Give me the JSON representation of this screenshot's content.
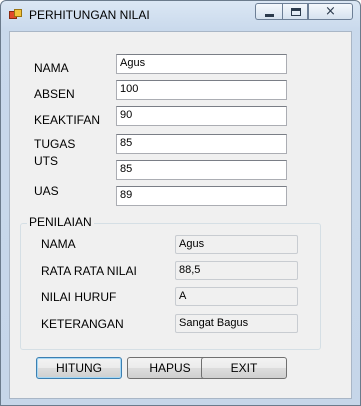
{
  "window": {
    "title": "PERHITUNGAN NILAI",
    "controls": {
      "minimize": "minimize",
      "maximize": "maximize",
      "close": "×"
    }
  },
  "form": {
    "fields": [
      {
        "label": "NAMA",
        "value": "Agus"
      },
      {
        "label": "ABSEN",
        "value": "100"
      },
      {
        "label": "KEAKTIFAN",
        "value": "90"
      },
      {
        "label": "TUGAS",
        "value": "85"
      },
      {
        "label": "UTS",
        "value": "85"
      },
      {
        "label": "UAS",
        "value": "89"
      }
    ]
  },
  "penilaian": {
    "title": "PENILAIAN",
    "rows": [
      {
        "label": "NAMA",
        "value": "Agus"
      },
      {
        "label": "RATA RATA NILAI",
        "value": "88,5"
      },
      {
        "label": "NILAI HURUF",
        "value": "A"
      },
      {
        "label": "KETERANGAN",
        "value": "Sangat Bagus"
      }
    ]
  },
  "buttons": {
    "hitung": "HITUNG",
    "hapus": "HAPUS",
    "exit": "EXIT"
  },
  "colors": {
    "titlebar": "#c9d9ec",
    "client": "#f0f0f0",
    "default_button_border": "#3c7fb1"
  }
}
